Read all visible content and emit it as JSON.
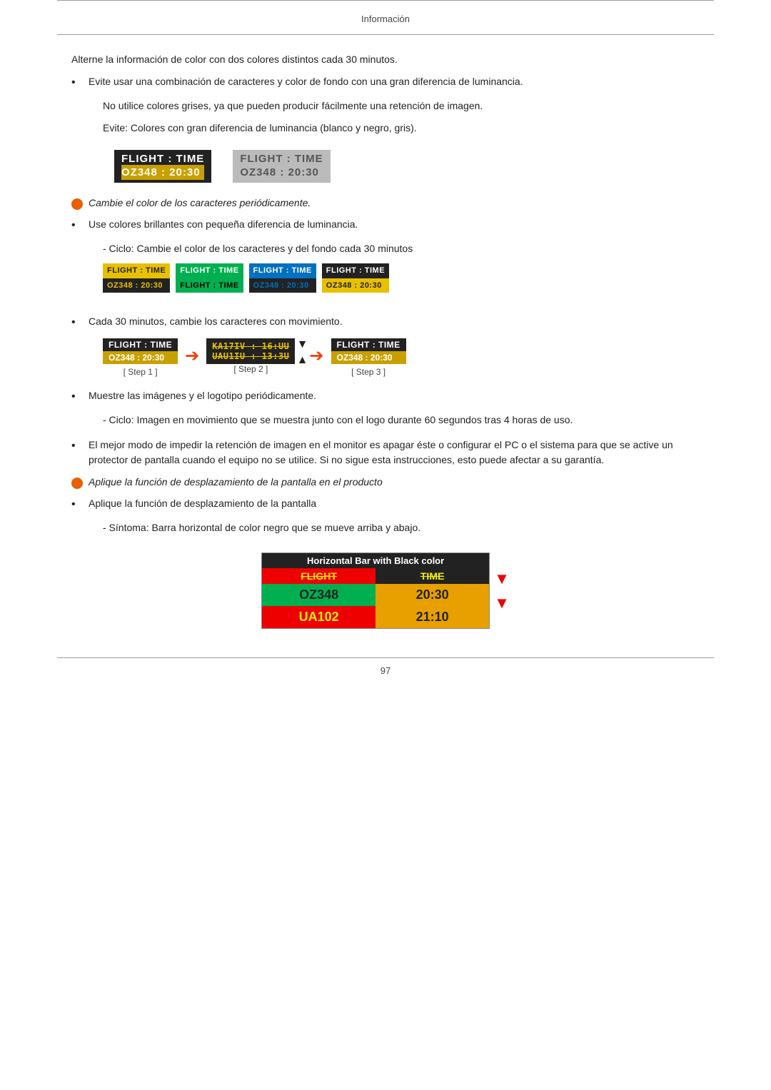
{
  "page": {
    "header": "Información",
    "footer": "97"
  },
  "content": {
    "intro_text": "Alterne la información de color con dos colores distintos cada 30 minutos.",
    "bullet1": {
      "dot": "•",
      "text": "Evite usar una combinación de caracteres y color de fondo con una gran diferencia de luminancia."
    },
    "sub_para1": "No utilice colores grises, ya que pueden producir fácilmente una retención de imagen.",
    "sub_para2": "Evite: Colores con gran diferencia de luminancia (blanco y negro, gris).",
    "flight_box_dark": {
      "row1": "FLIGHT  :  TIME",
      "row2": "OZ348   :  20:30"
    },
    "flight_box_gray": {
      "row1": "FLIGHT  :  TIME",
      "row2": "OZ348   :  20:30"
    },
    "orange_bullet1": {
      "text": "Cambie el color de los caracteres periódicamente."
    },
    "bullet2": {
      "dot": "•",
      "text": "Use colores brillantes con pequeña diferencia de luminancia."
    },
    "cycle_label": "- Ciclo: Cambie el color de los caracteres y del fondo cada 30 minutos",
    "cycle_boxes": [
      {
        "r1": "FLIGHT  :  TIME",
        "r2": "OZ348  :  20:30",
        "style": "yellow"
      },
      {
        "r1": "FLIGHT  :  TIME",
        "r2": "FLIGHT  :  TIME",
        "style": "green"
      },
      {
        "r1": "FLIGHT  :  TIME",
        "r2": "OZ348  :  20:30",
        "style": "blue"
      },
      {
        "r1": "FLIGHT  :  TIME",
        "r2": "OZ348  :  20:30",
        "style": "dark"
      }
    ],
    "bullet3": {
      "dot": "•",
      "text": "Cada 30 minutos, cambie los caracteres con movimiento."
    },
    "steps": [
      {
        "label": "[ Step 1 ]"
      },
      {
        "label": "[ Step 2 ]"
      },
      {
        "label": "[ Step 3 ]"
      }
    ],
    "step1_r1": "FLIGHT  :  TIME",
    "step1_r2": "OZ348  :  20:30",
    "step2_r1": "KA17IV : 16:UU",
    "step2_r2": "UAU1IU : 13:3U",
    "step3_r1": "FLIGHT  :  TIME",
    "step3_r2": "OZ348  :  20:30",
    "bullet4": {
      "dot": "•",
      "text": "Muestre las imágenes y el logotipo periódicamente."
    },
    "sub_para3": "- Ciclo: Imagen en movimiento que se muestra junto con el logo durante 60 segundos tras 4 horas de uso.",
    "bullet5": {
      "dot": "•",
      "text": "El mejor modo de impedir la retención de imagen en el monitor es apagar éste o configurar el PC o el sistema para que se active un protector de pantalla cuando el equipo no se utilice. Si no sigue esta instrucciones, esto puede afectar a su garantía."
    },
    "orange_bullet2": {
      "text": "Aplique la función de desplazamiento de la pantalla en el producto"
    },
    "bullet6": {
      "dot": "•",
      "text": "Aplique la función de desplazamiento de la pantalla"
    },
    "sub_para4": "- Síntoma: Barra horizontal de color negro que se mueve arriba y abajo.",
    "large_display": {
      "header": "Horizontal Bar with Black color",
      "col1_header": "FLIGHT",
      "col2_header": "TIME",
      "row1_col1": "OZ348",
      "row1_col2": "20:30",
      "row2_col1": "UA102",
      "row2_col2": "21:10"
    }
  }
}
